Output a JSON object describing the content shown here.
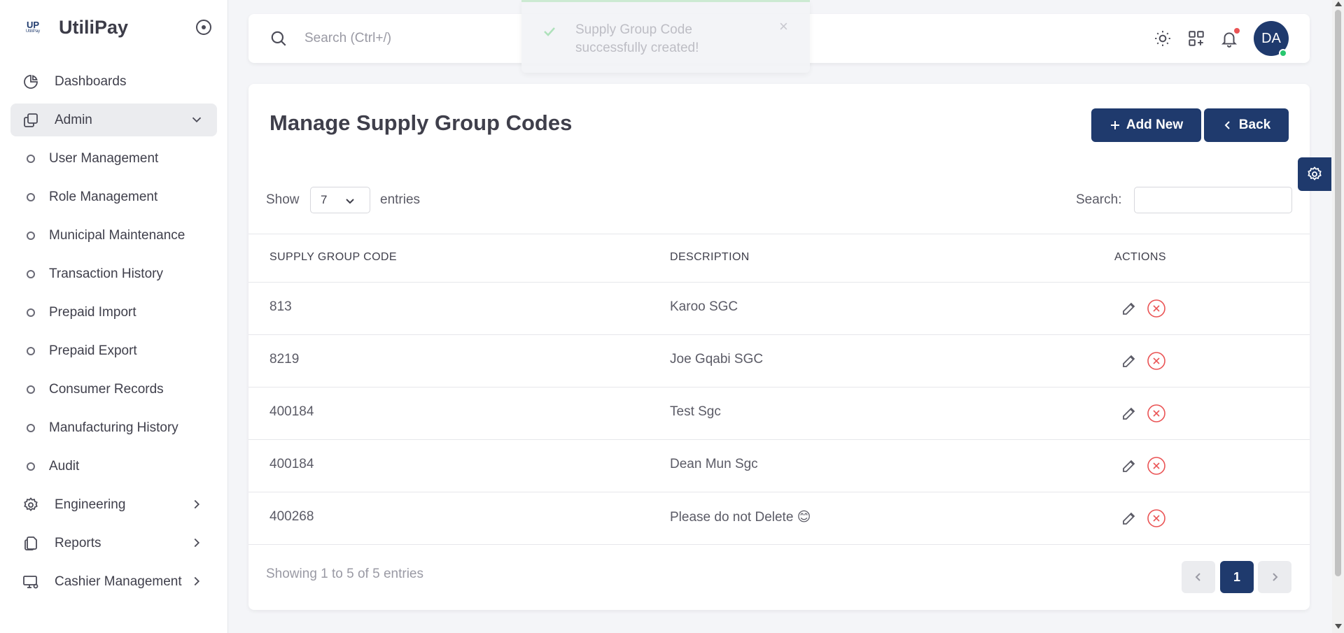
{
  "app": {
    "name": "UtiliPay",
    "logo_mark": "UP",
    "logo_sub": "UtiliPay"
  },
  "sidebar": {
    "items": [
      {
        "label": "Dashboards",
        "icon": "pie-chart-icon"
      },
      {
        "label": "Admin",
        "icon": "copy-icon",
        "expanded": true
      },
      {
        "label": "User Management"
      },
      {
        "label": "Role Management"
      },
      {
        "label": "Municipal Maintenance"
      },
      {
        "label": "Transaction History"
      },
      {
        "label": "Prepaid Import"
      },
      {
        "label": "Prepaid Export"
      },
      {
        "label": "Consumer Records"
      },
      {
        "label": "Manufacturing History"
      },
      {
        "label": "Audit"
      },
      {
        "label": "Engineering",
        "icon": "gear-icon"
      },
      {
        "label": "Reports",
        "icon": "files-icon"
      },
      {
        "label": "Cashier Management",
        "icon": "monitor-gear-icon"
      }
    ]
  },
  "topbar": {
    "search_placeholder": "Search (Ctrl+/)",
    "avatar_initials": "DA"
  },
  "toast": {
    "message": "Supply Group Code successfully created!",
    "close": "×"
  },
  "page": {
    "title": "Manage Supply Group Codes",
    "add_label": "Add New",
    "back_label": "Back"
  },
  "table_controls": {
    "show_label": "Show",
    "entries_value": "7",
    "entries_label": "entries",
    "search_label": "Search:"
  },
  "table": {
    "headers": [
      "SUPPLY GROUP CODE",
      "DESCRIPTION",
      "ACTIONS"
    ],
    "rows": [
      {
        "code": "813",
        "description": "Karoo SGC"
      },
      {
        "code": "8219",
        "description": "Joe Gqabi SGC"
      },
      {
        "code": "400184",
        "description": "Test Sgc"
      },
      {
        "code": "400184",
        "description": "Dean Mun Sgc"
      },
      {
        "code": "400268",
        "description": "Please do not Delete 😊"
      }
    ]
  },
  "footer": {
    "showing": "Showing 1 to 5 of 5 entries",
    "current_page": "1"
  },
  "colors": {
    "primary": "#1f3a6d",
    "danger": "#ea5455",
    "success": "#28c76f"
  }
}
